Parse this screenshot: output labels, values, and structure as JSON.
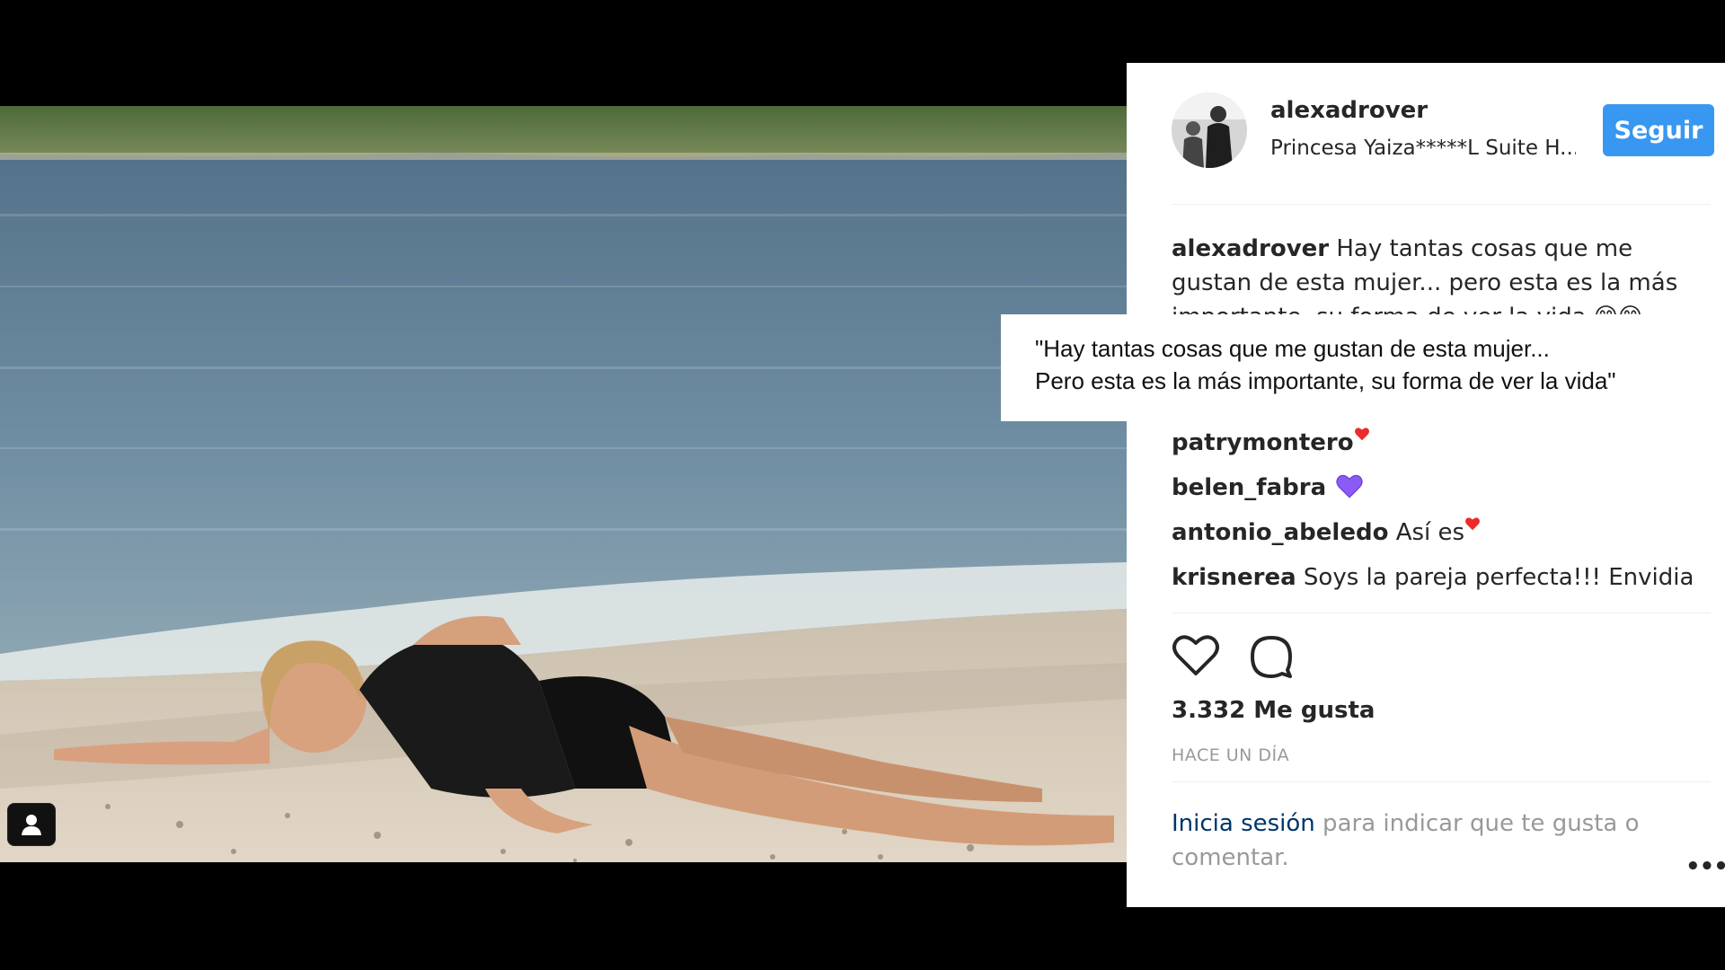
{
  "post": {
    "username": "alexadrover",
    "location": "Princesa Yaiza*****L Suite H...",
    "follow_label": "Seguir"
  },
  "caption": {
    "username": "alexadrover",
    "text": "Hay tantas cosas que me gustan de esta mujer... pero esta es la más importante, su forma de ver la vida 😊😊"
  },
  "quote_overlay": {
    "text": "\"Hay tantas cosas que me gustan de esta mujer...\nPero esta es la más importante, su forma de ver la vida\""
  },
  "comments": [
    {
      "username": "patrymontero",
      "text": "",
      "icon": "red-heart-icon"
    },
    {
      "username": "belen_fabra",
      "text": "",
      "icon": "purple-heart-icon"
    },
    {
      "username": "antonio_abeledo",
      "text": "Así es",
      "icon": "red-heart-icon"
    },
    {
      "username": "krisnerea",
      "text": "Soys la pareja perfecta!!! Envidia"
    }
  ],
  "likes_label": "3.332 Me gusta",
  "timestamp": "HACE UN DÍA",
  "login": {
    "link_label": "Inicia sesión",
    "text": " para indicar que te gusta o comentar."
  },
  "more_label": "•••",
  "colors": {
    "follow_button": "#3897f0",
    "link": "#003569",
    "red_heart": "#ed2b2b",
    "purple_heart": "#8a5cf5"
  }
}
